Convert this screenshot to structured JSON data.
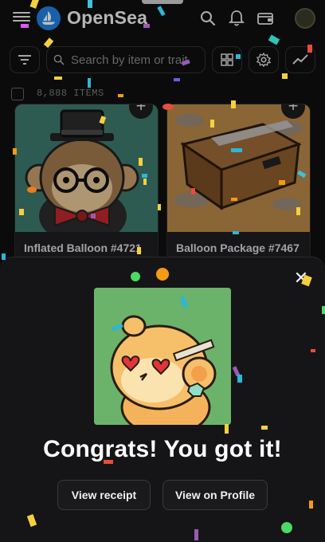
{
  "nav": {
    "brand": "OpenSea",
    "icons": [
      "menu-icon",
      "opensea-logo",
      "search-icon",
      "bell-icon",
      "wallet-icon",
      "profile-avatar"
    ]
  },
  "search": {
    "placeholder": "Search by item or trait"
  },
  "toolbar": {
    "icons": [
      "filter-icon",
      "grid-icon",
      "settings-icon",
      "activity-chart-icon"
    ]
  },
  "collection": {
    "items_count": "8,888 ITEMS"
  },
  "cards": [
    {
      "name": "Inflated Balloon #4721",
      "bg": "#3e7a6c"
    },
    {
      "name": "Balloon Package #7467",
      "bg": "#b88748"
    }
  ],
  "modal": {
    "heading": "Congrats! You got it!",
    "view_receipt": "View receipt",
    "view_profile": "View on Profile",
    "close_icon": "close-icon",
    "art_bg": "#6bb36a"
  },
  "colors": {
    "background": "#0f0f10",
    "sheet": "#151517",
    "accent": "#2081e2"
  }
}
